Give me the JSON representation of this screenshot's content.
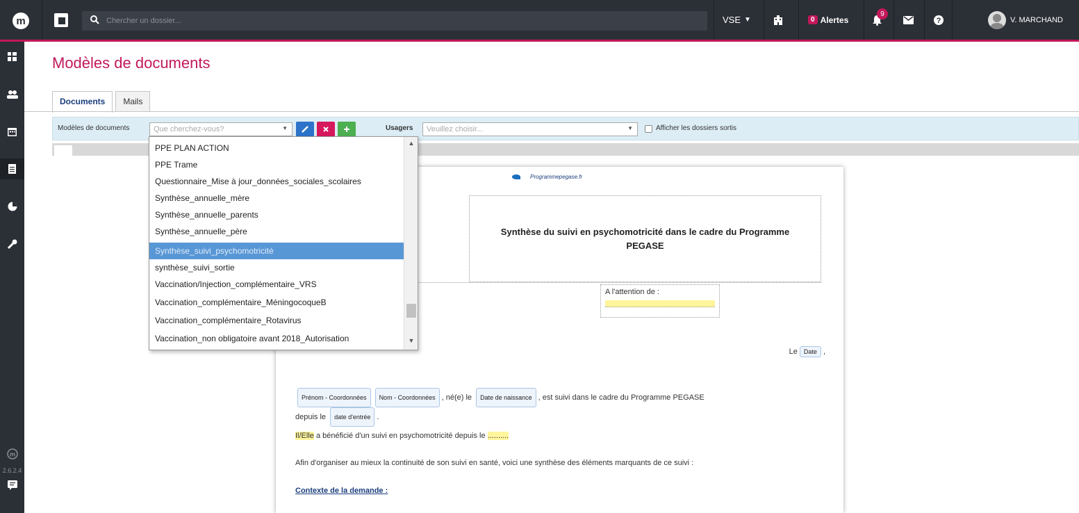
{
  "topbar": {
    "logo_letter": "m",
    "search_placeholder": "Chercher un dossier...",
    "structure": "VSE",
    "alerts_count": "0",
    "alerts_label": "Alertes",
    "notifications_count": "9",
    "username": "V. MARCHAND"
  },
  "sidebar": {
    "version": "2.6.2.4"
  },
  "page": {
    "title": "Modèles de documents"
  },
  "tabs": [
    "Documents",
    "Mails"
  ],
  "toolbar": {
    "models_label": "Modèles de documents",
    "models_placeholder": "Que cherchez-vous?",
    "usagers_label": "Usagers",
    "usagers_placeholder": "Veuillez choisir...",
    "show_exited_label": "Afficher les dossiers sortis"
  },
  "dropdown": {
    "items": [
      "PPE PLAN ACTION",
      "PPE Trame",
      "Questionnaire_Mise à jour_données_sociales_scolaires",
      "Synthèse_annuelle_mère",
      "Synthèse_annuelle_parents",
      "Synthèse_annuelle_père",
      "Synthèse_suivi_psychomotricité",
      "synthèse_suivi_sortie",
      "Vaccination/Injection_complémentaire_VRS",
      "Vaccination_complémentaire_MéningocoqueB",
      "Vaccination_complémentaire_Rotavirus",
      "Vaccination_non obligatoire avant 2018_Autorisation"
    ],
    "selected_index": 6
  },
  "document": {
    "logo_text": "Programmepegase.fr",
    "title": "Synthèse du suivi en psychomotricité dans le cadre du Programme PEGASE",
    "attention_label": "A l'attention de :",
    "date_prefix": "Le",
    "date_chip": "Date",
    "date_suffix": ",",
    "chip_prenom": "Prénom - Coordonnées",
    "chip_nom": "Nom - Coordonnées",
    "text_nee": ", né(e) le",
    "chip_naissance": "Date de naissance",
    "text_suivi": ", est suivi dans le cadre du Programme PEGASE",
    "text_depuis": "depuis le",
    "chip_entree": "date d'entrée",
    "text_dot": ".",
    "il_elle": "Il/Elle",
    "text_beneficie": "a bénéficié d'un suivi en psychomotricité depuis le",
    "blank": "..........",
    "para3": "Afin d'organiser au mieux la continuité de son suivi en santé, voici une synthèse des éléments marquants de ce suivi :",
    "heading": "Contexte de la demande :"
  }
}
